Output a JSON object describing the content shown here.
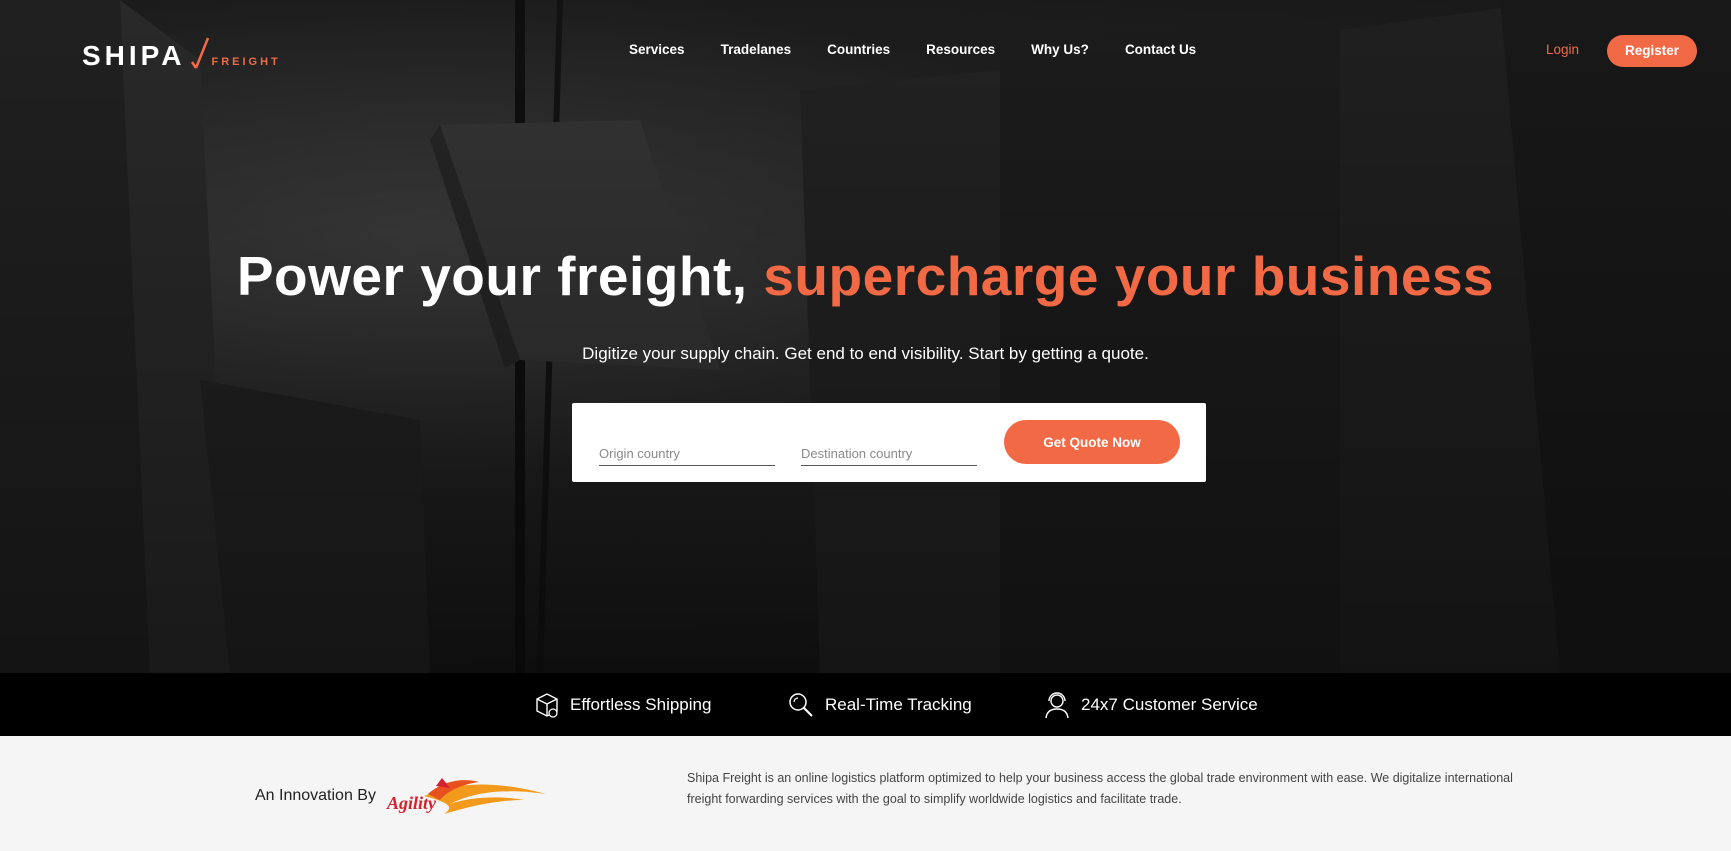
{
  "logo": {
    "main": "SHIPA",
    "sub": "FREIGHT"
  },
  "nav": {
    "items": [
      {
        "label": "Services"
      },
      {
        "label": "Tradelanes"
      },
      {
        "label": "Countries"
      },
      {
        "label": "Resources"
      },
      {
        "label": "Why Us?"
      },
      {
        "label": "Contact Us"
      }
    ],
    "login": "Login",
    "register": "Register"
  },
  "hero": {
    "headline_white": "Power your freight, ",
    "headline_accent": "supercharge your business",
    "subline": "Digitize your supply chain. Get end to end visibility. Start by getting a quote."
  },
  "quote": {
    "origin_placeholder": "Origin country",
    "destination_placeholder": "Destination country",
    "button": "Get Quote Now"
  },
  "features": [
    {
      "label": "Effortless Shipping",
      "icon": "package-icon"
    },
    {
      "label": "Real-Time Tracking",
      "icon": "magnifier-icon"
    },
    {
      "label": "24x7 Customer Service",
      "icon": "support-agent-icon"
    }
  ],
  "innovation": {
    "text": "An Innovation By",
    "brand": "Agility"
  },
  "about": "Shipa Freight is an online logistics platform optimized to help your business access the global trade environment with ease. We digitalize international freight forwarding services with the goal to simplify worldwide logistics and facilitate trade.",
  "colors": {
    "accent": "#f26a45",
    "dark": "#000000",
    "light_bg": "#f5f5f6"
  }
}
